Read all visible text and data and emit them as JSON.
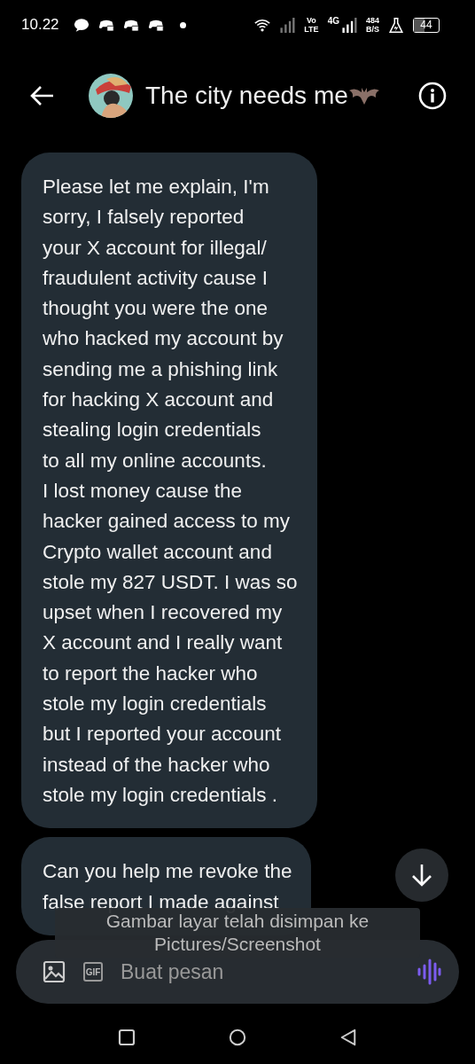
{
  "status_bar": {
    "time": "10.22",
    "volte": [
      "Vo",
      "LTE"
    ],
    "network": "4G",
    "speed": [
      "484",
      "B/S"
    ],
    "battery": "44"
  },
  "header": {
    "title": "The city needs me"
  },
  "messages": [
    {
      "text": "Please let me explain, I'm\nsorry, I falsely reported\nyour X account for illegal/\nfraudulent activity cause I\nthought you were the one\nwho hacked my account by\nsending me a phishing link\nfor hacking X account and\nstealing login credentials\nto all my online accounts.\nI lost money cause the\nhacker gained access to my\nCrypto wallet account and\nstole my 827 USDT. I was so\nupset when I recovered my\nX account and I really want\nto report the hacker who\nstole my login credentials\nbut I reported your account\ninstead of the hacker who\nstole my login credentials ."
    },
    {
      "text": "Can you help me revoke the\nfalse report I made against"
    }
  ],
  "toast": {
    "lines": [
      "Gambar layar telah disimpan ke",
      "Pictures/Screenshot"
    ]
  },
  "composer": {
    "gif_label": "GIF",
    "placeholder": "Buat pesan"
  }
}
